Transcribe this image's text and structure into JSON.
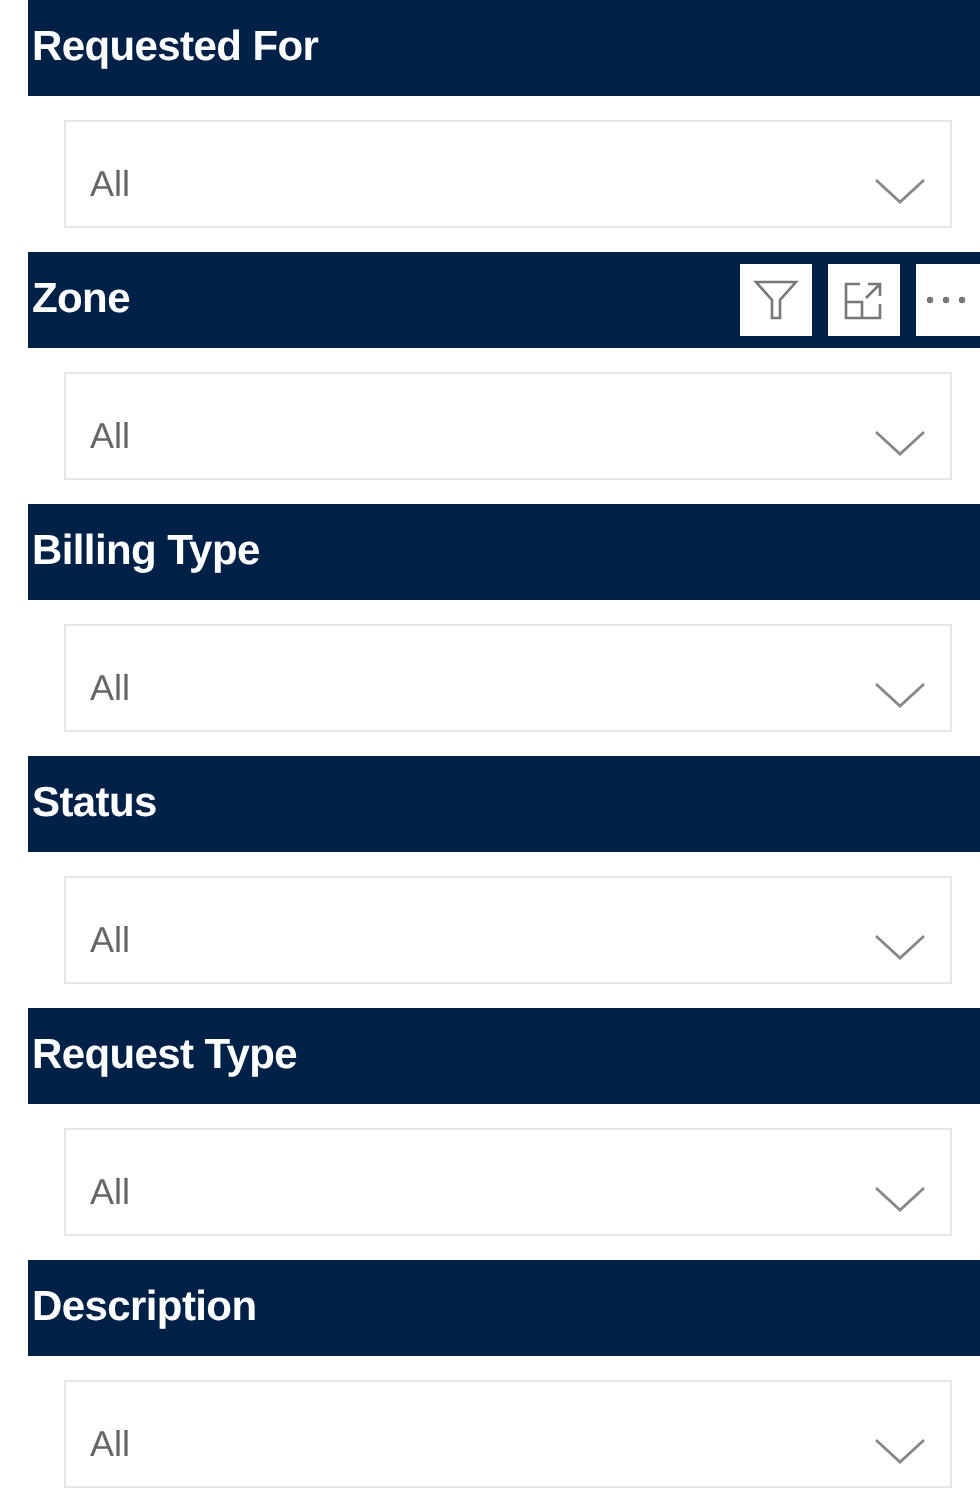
{
  "slicers": [
    {
      "title": "Requested For",
      "value": "All",
      "toolbar_visible": false
    },
    {
      "title": "Zone",
      "value": "All",
      "toolbar_visible": true
    },
    {
      "title": "Billing Type",
      "value": "All",
      "toolbar_visible": false
    },
    {
      "title": "Status",
      "value": "All",
      "toolbar_visible": false
    },
    {
      "title": "Request Type",
      "value": "All",
      "toolbar_visible": false
    },
    {
      "title": "Description",
      "value": "All",
      "toolbar_visible": false
    }
  ]
}
